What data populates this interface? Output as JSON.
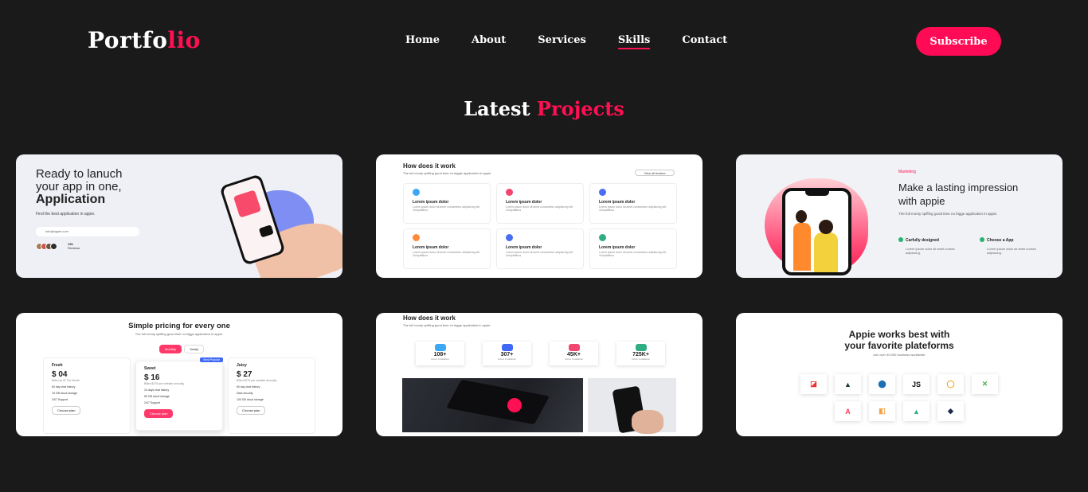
{
  "header": {
    "logo_main": "Portfo",
    "logo_accent": "lio",
    "nav": [
      "Home",
      "About",
      "Services",
      "Skills",
      "Contact"
    ],
    "active_nav": "Skills",
    "subscribe_label": "Subscribe"
  },
  "section": {
    "title_main": "Latest ",
    "title_accent": "Projects"
  },
  "colors": {
    "accent": "#ff1053",
    "background": "#1a1a1b"
  },
  "projects": [
    {
      "heading_line1": "Ready to lanuch",
      "heading_line2": "your app in one,",
      "heading_bold": "Application",
      "subtext": "Find the best application in appie.",
      "search_placeholder": "info@appie.com",
      "reviews": "15k",
      "reviews_label": "Reviews"
    },
    {
      "title": "How does it work",
      "subtitle": "The full monty spiffing good time no biggie application in appie.",
      "view_all": "View all feature",
      "boxes": [
        {
          "title": "Lorem ipsum dolor",
          "text": "Lorem ipsum dolor sit amet consectetur adipisicing elit. Voluptatibus",
          "color": "#3ca8f5"
        },
        {
          "title": "Lorem ipsum dolor",
          "text": "Lorem ipsum dolor sit amet consectetur adipisicing elit. Voluptatibus",
          "color": "#f2466e"
        },
        {
          "title": "Lorem ipsum dolor",
          "text": "Lorem ipsum dolor sit amet consectetur adipisicing elit. Voluptatibus",
          "color": "#4a6ef2"
        },
        {
          "title": "Lorem ipsum dolor",
          "text": "Lorem ipsum dolor sit amet consectetur adipisicing elit. Voluptatibus",
          "color": "#ff8a3c"
        },
        {
          "title": "Lorem ipsum dolor",
          "text": "Lorem ipsum dolor sit amet consectetur adipisicing elit. Voluptatibus",
          "color": "#4a6ef2"
        },
        {
          "title": "Lorem ipsum dolor",
          "text": "Lorem ipsum dolor sit amet consectetur adipisicing elit. Voluptatibus",
          "color": "#2fae84"
        }
      ]
    },
    {
      "kicker": "Marketing",
      "title": "Make a lasting impression with appie",
      "subtitle": "The full monty spiffing good time no bigge application in appie.",
      "feature1": "Carfully designed",
      "feature1_text": "Lorem ipsum dolor sit amet consec adipiscing.",
      "feature2": "Choose a App",
      "feature2_text": "Lorem ipsum dolor sit amet consec adipiscing."
    },
    {
      "title": "Simple pricing for every one",
      "subtitle": "The full monty spiffing good time no bigge application in appie.",
      "toggle_on": "Monthly",
      "toggle_off": "Yearly",
      "plans": [
        {
          "name": "Fresh",
          "price": "$ 04",
          "desc": "Billed as $? Per Month",
          "features": [
            "60 day chat history",
            "15 GB cloud storage",
            "24/7 Support",
            ""
          ],
          "cta": "Choose plan"
        },
        {
          "name": "Sweet",
          "price": "$ 16",
          "desc": "Billed $276 per website annually",
          "features": [
            "10 days chat history",
            "50 GB cloud storage",
            "24/7 Support"
          ],
          "cta": "Choose plan",
          "badge": "Most Popular"
        },
        {
          "name": "Juicy",
          "price": "$ 27",
          "desc": "Billed $276 per website annually",
          "features": [
            "60 day chat history",
            "Data security",
            "100 GB cloud storage",
            "24/7 Support"
          ],
          "cta": "Choose plan"
        }
      ]
    },
    {
      "title": "How does it work",
      "subtitle": "The full monty spiffing good time no bigge application in appie.",
      "stats": [
        {
          "value": "108+",
          "label": "Active Installation",
          "color": "#3ca8f5"
        },
        {
          "value": "307+",
          "label": "Active Installation",
          "color": "#3f68f6"
        },
        {
          "value": "45K+",
          "label": "Active Installation",
          "color": "#f2466e"
        },
        {
          "value": "725K+",
          "label": "Active Installation",
          "color": "#2fae84"
        }
      ]
    },
    {
      "title_line1": "Appie works best with",
      "title_line2": "your favorite plateforms",
      "subtitle": "Join over 40,000 business worldwide.",
      "platforms_row1": [
        {
          "glyph": "◪",
          "color": "#e33"
        },
        {
          "glyph": "▲",
          "color": "#1c3a2e"
        },
        {
          "glyph": "⬤",
          "color": "#1b6fb3"
        },
        {
          "glyph": "JS",
          "color": "#111"
        },
        {
          "glyph": "◯",
          "color": "#f2a20d"
        },
        {
          "glyph": "✕",
          "color": "#4caf50"
        }
      ],
      "platforms_row2": [
        {
          "glyph": "A",
          "color": "#ff3a5c"
        },
        {
          "glyph": "◧",
          "color": "#f4a340"
        },
        {
          "glyph": "▲",
          "color": "#2fae84"
        },
        {
          "glyph": "◆",
          "color": "#1c2a4a"
        }
      ]
    }
  ]
}
